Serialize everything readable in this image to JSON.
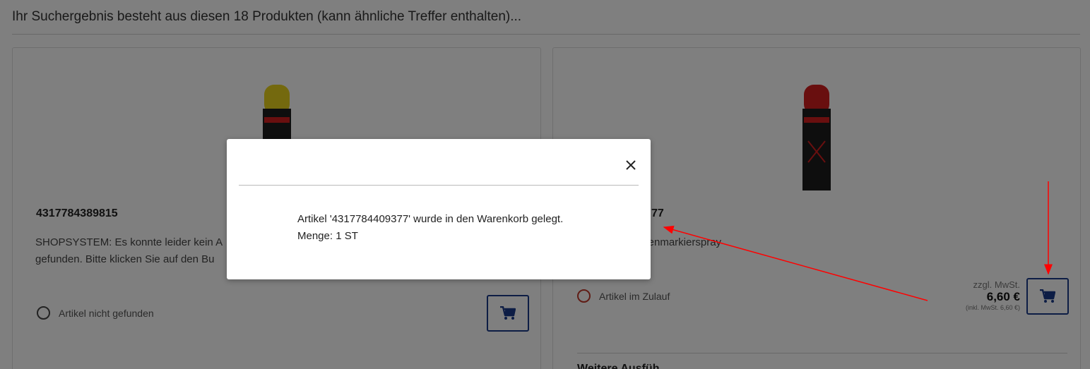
{
  "page": {
    "heading": "Ihr Suchergebnis besteht aus diesen 18 Produkten (kann ähnliche Treffer enthalten)..."
  },
  "products": [
    {
      "sku": "4317784389815",
      "description_line1": "SHOPSYSTEM: Es konnte leider kein A",
      "description_line2": "gefunden. Bitte klicken Sie auf den Bu",
      "status": "Artikel nicht gefunden",
      "can_color": "#e8d21c"
    },
    {
      "sku_fragment": "77",
      "description_line1": "llenmarkierspray",
      "status": "Artikel im Zulauf",
      "price_note": "zzgl. MwSt.",
      "price": "6,60 €",
      "price_incl": "(inkl. MwSt. 6,60 €)",
      "more_heading": "Weitere Ausfüh",
      "can_color": "#d21f1f"
    }
  ],
  "modal": {
    "message_line1": "Artikel '4317784409377' wurde in den Warenkorb gelegt.",
    "message_line2": "Menge: 1 ST",
    "close_icon": "close-icon"
  },
  "colors": {
    "accent": "#1a3a8a",
    "annotation": "#ff0000"
  }
}
